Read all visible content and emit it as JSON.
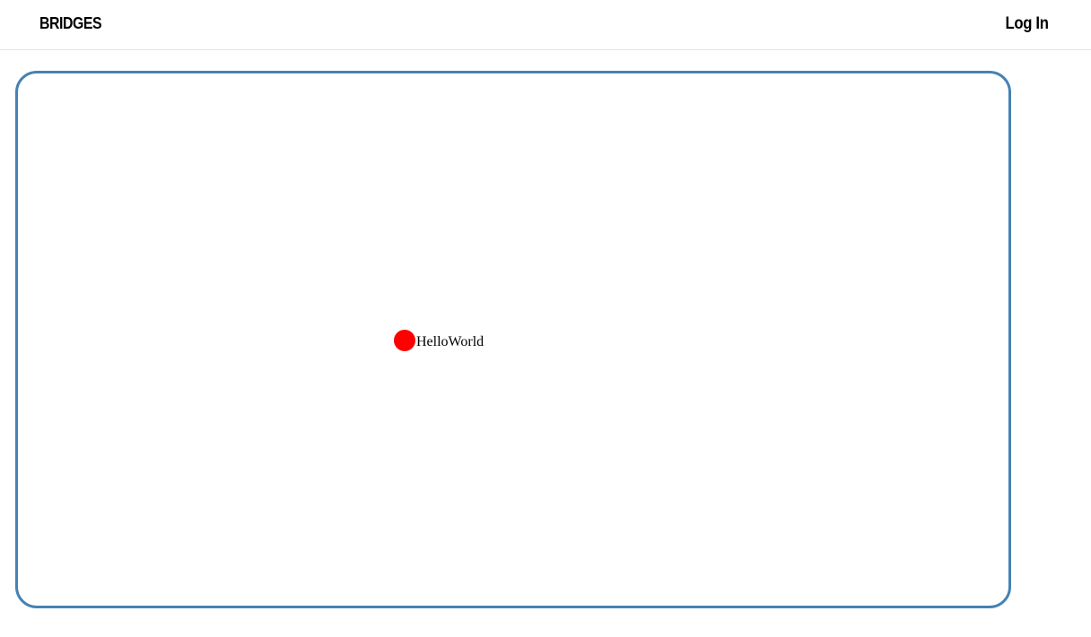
{
  "header": {
    "brand": "BRIDGES",
    "login_label": "Log In"
  },
  "graph": {
    "nodes": [
      {
        "label": "HelloWorld",
        "color": "#ff0000"
      }
    ],
    "edges": []
  },
  "colors": {
    "frame_border": "#4682b4",
    "node": "#ff0000",
    "header_divider": "#e3e3e3"
  }
}
